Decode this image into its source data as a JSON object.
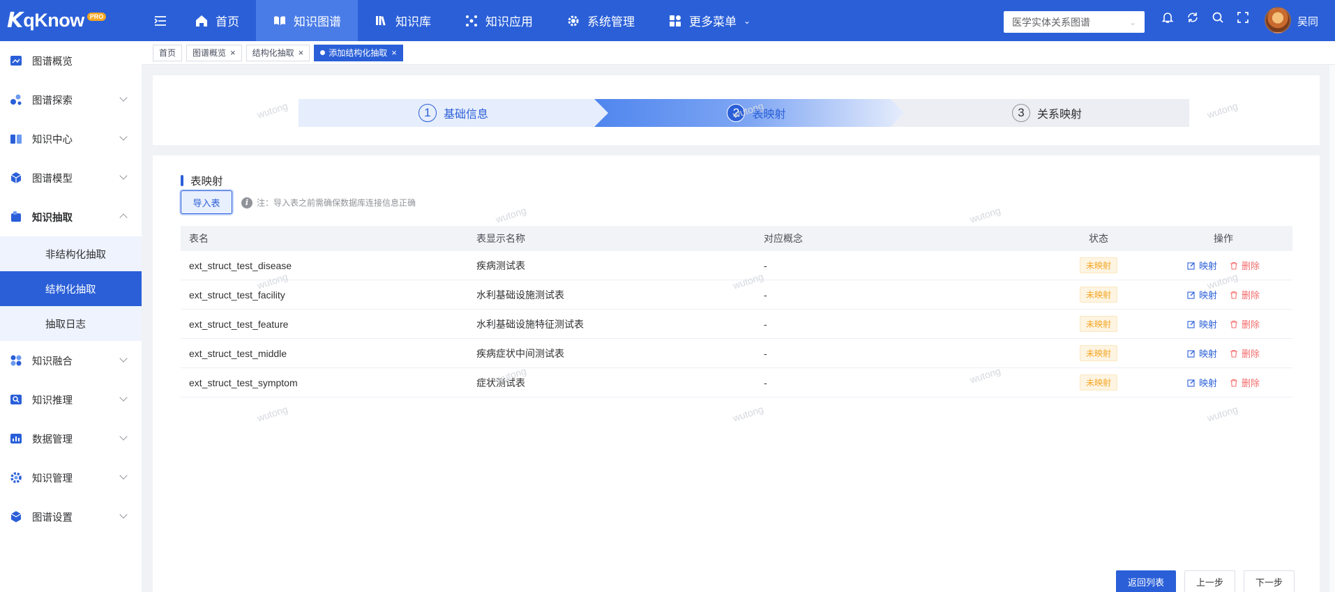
{
  "topbar": {
    "logo_mark": "K",
    "logo_text": "qKnow",
    "logo_badge": "PRO",
    "nav": [
      {
        "label": "首页",
        "icon": "home-icon",
        "active": false
      },
      {
        "label": "知识图谱",
        "icon": "book-open-icon",
        "active": true
      },
      {
        "label": "知识库",
        "icon": "library-icon",
        "active": false
      },
      {
        "label": "知识应用",
        "icon": "grid-dots-icon",
        "active": false
      },
      {
        "label": "系统管理",
        "icon": "gear-icon",
        "active": false
      },
      {
        "label": "更多菜单",
        "icon": "apps-icon",
        "active": false
      }
    ],
    "graph_select": "医学实体关系图谱",
    "username": "吴同"
  },
  "sidebar": {
    "items": [
      {
        "label": "图谱概览",
        "icon": "overview-icon"
      },
      {
        "label": "图谱探索",
        "icon": "explore-icon"
      },
      {
        "label": "知识中心",
        "icon": "knowledge-center-icon"
      },
      {
        "label": "图谱模型",
        "icon": "model-icon"
      },
      {
        "label": "知识抽取",
        "icon": "extraction-icon"
      },
      {
        "label": "知识融合",
        "icon": "fusion-icon"
      },
      {
        "label": "知识推理",
        "icon": "reasoning-icon"
      },
      {
        "label": "数据管理",
        "icon": "data-icon"
      },
      {
        "label": "知识管理",
        "icon": "management-icon"
      },
      {
        "label": "图谱设置",
        "icon": "settings-icon"
      }
    ],
    "sub_items": [
      "非结构化抽取",
      "结构化抽取",
      "抽取日志"
    ]
  },
  "tabs": [
    {
      "label": "首页"
    },
    {
      "label": "图谱概览"
    },
    {
      "label": "结构化抽取"
    },
    {
      "label": "添加结构化抽取"
    }
  ],
  "steps": [
    {
      "num": "1",
      "label": "基础信息"
    },
    {
      "num": "2",
      "label": "表映射"
    },
    {
      "num": "3",
      "label": "关系映射"
    }
  ],
  "section": {
    "title": "表映射",
    "import_label": "导入表",
    "note": "注：导入表之前需确保数据库连接信息正确"
  },
  "table": {
    "headers": [
      "表名",
      "表显示名称",
      "对应概念",
      "状态",
      "操作"
    ],
    "rows": [
      {
        "name": "ext_struct_test_disease",
        "display": "疾病测试表",
        "concept": "-",
        "status": "未映射"
      },
      {
        "name": "ext_struct_test_facility",
        "display": "水利基础设施测试表",
        "concept": "-",
        "status": "未映射"
      },
      {
        "name": "ext_struct_test_feature",
        "display": "水利基础设施特征测试表",
        "concept": "-",
        "status": "未映射"
      },
      {
        "name": "ext_struct_test_middle",
        "display": "疾病症状中间测试表",
        "concept": "-",
        "status": "未映射"
      },
      {
        "name": "ext_struct_test_symptom",
        "display": "症状测试表",
        "concept": "-",
        "status": "未映射"
      }
    ],
    "op_map": "映射",
    "op_delete": "删除"
  },
  "footer": {
    "back_label": "返回列表",
    "prev_label": "上一步",
    "next_label": "下一步"
  },
  "watermark": "wutong",
  "colors": {
    "primary": "#2a5fd8",
    "warning": "#f5a623",
    "danger": "#f56c6c"
  }
}
